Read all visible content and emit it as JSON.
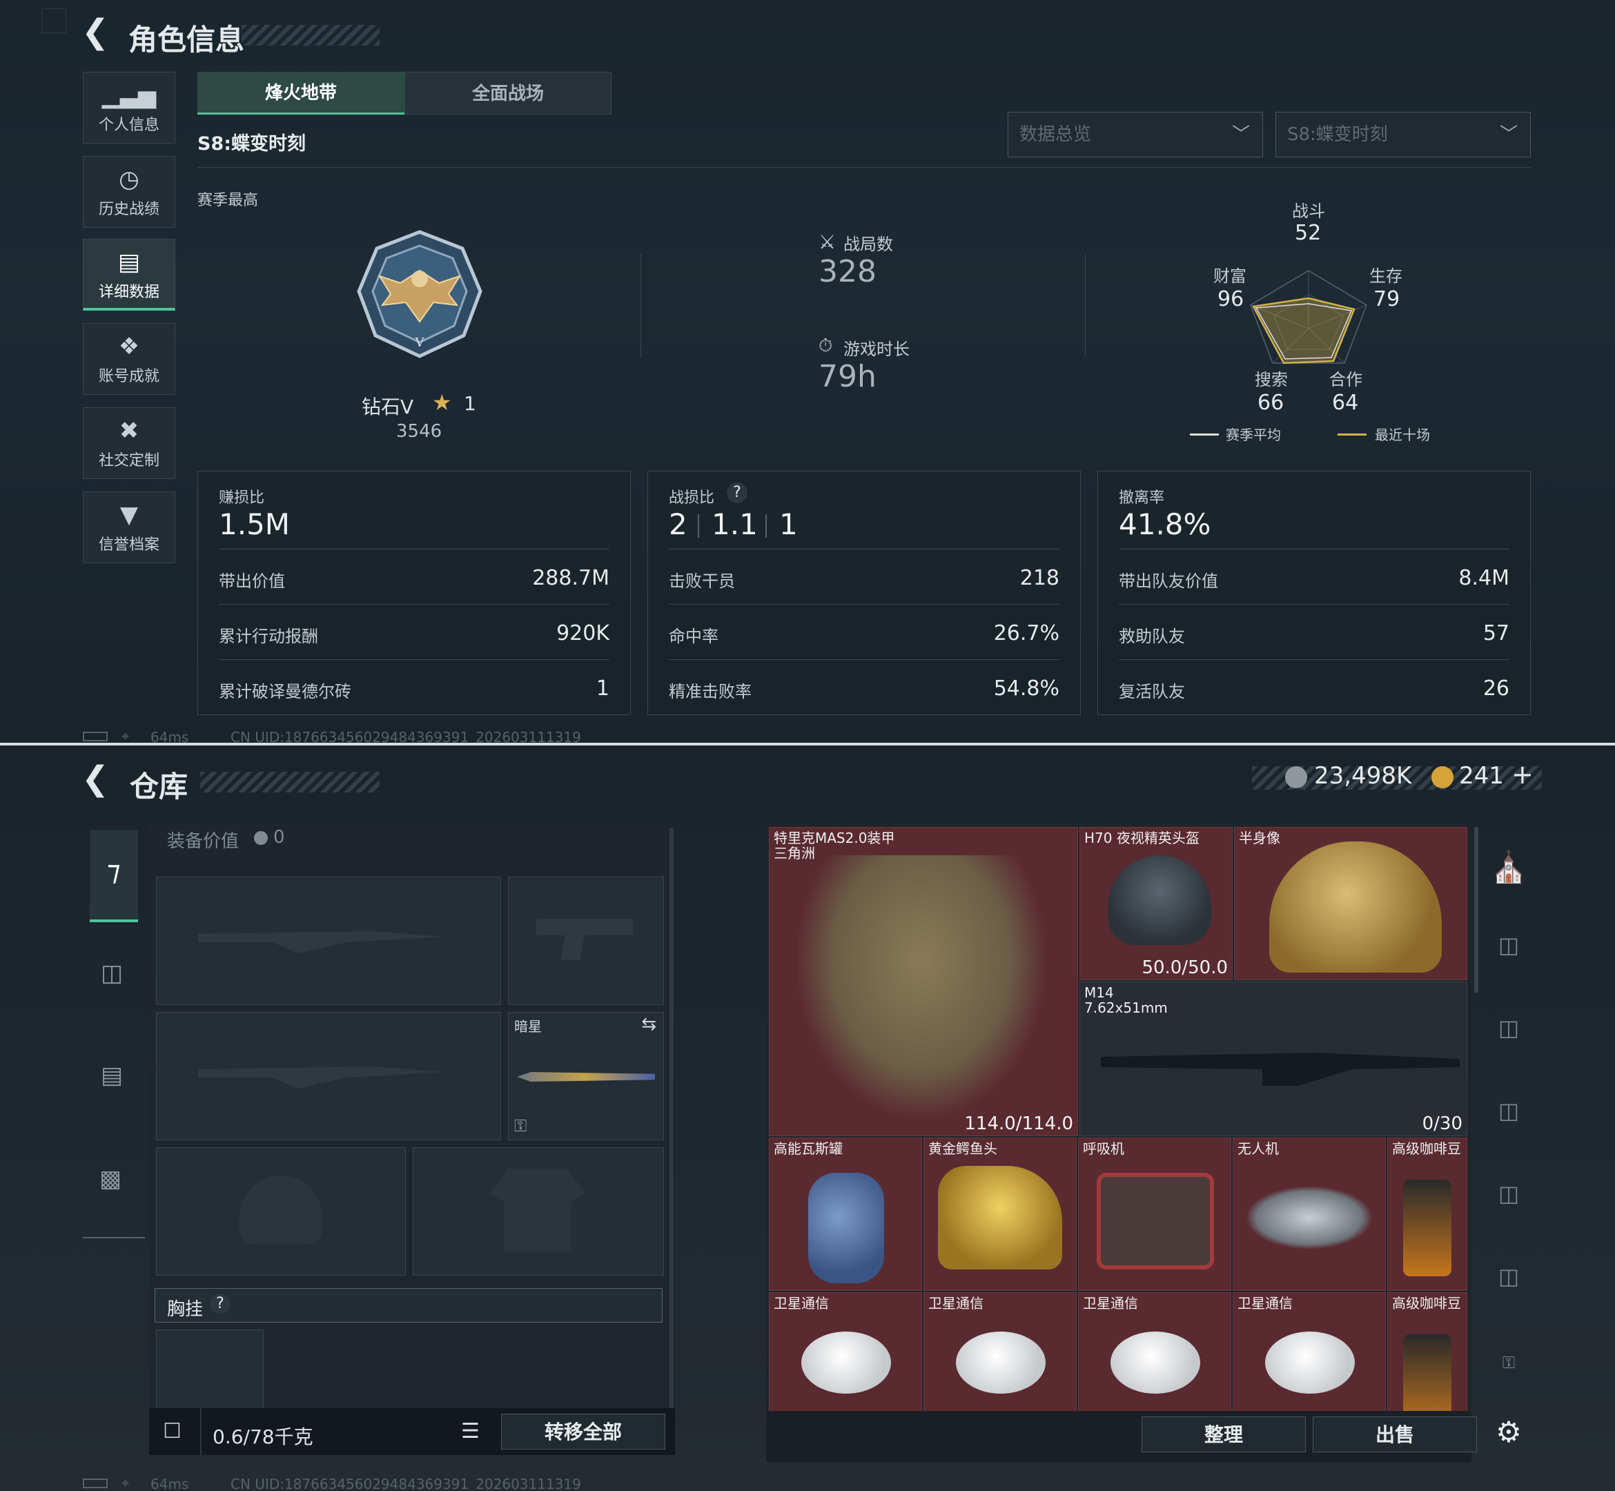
{
  "top": {
    "title": "角色信息",
    "sidebar": [
      {
        "icon": "bar-chart-icon",
        "label": "个人信息"
      },
      {
        "icon": "history-icon",
        "label": "历史战绩"
      },
      {
        "icon": "detail-data-icon",
        "label": "详细数据"
      },
      {
        "icon": "achievement-icon",
        "label": "账号成就"
      },
      {
        "icon": "tools-icon",
        "label": "社交定制"
      },
      {
        "icon": "credit-icon",
        "label": "信誉档案"
      }
    ],
    "tabs": [
      "烽火地带",
      "全面战场"
    ],
    "season_label": "S8:蝶变时刻",
    "dropdown1": "数据总览",
    "dropdown2": "S8:蝶变时刻",
    "season_best": "赛季最高",
    "rank_name": "钻石V",
    "rank_stars": "1",
    "rank_score": "3546",
    "matches_label": "战局数",
    "matches_value": "328",
    "playtime_label": "游戏时长",
    "playtime_value": "79h",
    "radar": {
      "combat_label": "战斗",
      "combat": "52",
      "wealth_label": "财富",
      "wealth": "96",
      "survival_label": "生存",
      "survival": "79",
      "search_label": "搜索",
      "search": "66",
      "coop_label": "合作",
      "coop": "64",
      "legend_avg": "赛季平均",
      "legend_recent": "最近十场",
      "avg_color": "#e0e0e0",
      "recent_color": "#d4b24a"
    },
    "cards": [
      {
        "title": "赚损比",
        "big": "1.5M",
        "rows": [
          [
            "带出价值",
            "288.7M"
          ],
          [
            "累计行动报酬",
            "920K"
          ],
          [
            "累计破译曼德尔砖",
            "1"
          ]
        ]
      },
      {
        "title": "战损比",
        "big_a": "2",
        "big_b": "1.1",
        "big_c": "1",
        "rows": [
          [
            "击败干员",
            "218"
          ],
          [
            "命中率",
            "26.7%"
          ],
          [
            "精准击败率",
            "54.8%"
          ]
        ]
      },
      {
        "title": "撤离率",
        "big": "41.8%",
        "rows": [
          [
            "带出队友价值",
            "8.4M"
          ],
          [
            "救助队友",
            "57"
          ],
          [
            "复活队友",
            "26"
          ]
        ]
      }
    ],
    "ping": "64ms",
    "uid": "CN UID:187663456029484369391_202603111319"
  },
  "bottom": {
    "title": "仓库",
    "currency1": "23,498K",
    "currency2": "241",
    "equip_value_label": "装备价值",
    "equip_value": "0",
    "knife_label": "暗星",
    "chest_label": "胸挂",
    "weight": "0.6/78千克",
    "transfer_all": "转移全部",
    "items": [
      {
        "label": "特里克MAS2.0装甲\n三角洲",
        "value": "114.0/114.0"
      },
      {
        "label": "H70 夜视精英头盔",
        "value": "50.0/50.0"
      },
      {
        "label": "半身像",
        "value": ""
      },
      {
        "label": "M14\n7.62x51mm",
        "value": "0/30"
      },
      {
        "label": "高能瓦斯罐",
        "value": ""
      },
      {
        "label": "黄金鳄鱼头",
        "value": ""
      },
      {
        "label": "呼吸机",
        "value": ""
      },
      {
        "label": "无人机",
        "value": ""
      },
      {
        "label": "高级咖啡豆",
        "value": ""
      },
      {
        "label": "卫星通信",
        "value": ""
      },
      {
        "label": "卫星通信",
        "value": ""
      },
      {
        "label": "卫星通信",
        "value": ""
      },
      {
        "label": "卫星通信",
        "value": ""
      },
      {
        "label": "高级咖啡豆",
        "value": ""
      }
    ],
    "sort_btn": "整理",
    "sell_btn": "出售",
    "ping": "64ms",
    "uid": "CN UID:187663456029484369391_202603111319"
  }
}
